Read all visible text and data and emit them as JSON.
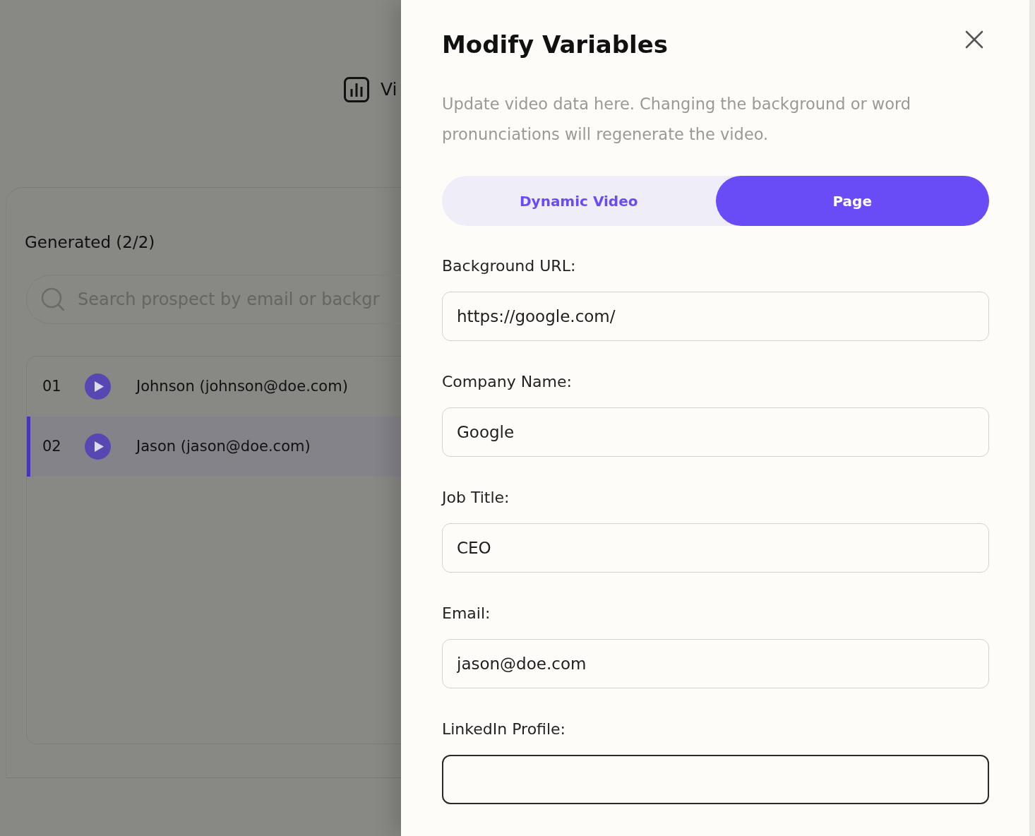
{
  "background_page": {
    "toolbar_button": {
      "label": "Vi"
    },
    "section": {
      "title": "Generated (2/2)",
      "search": {
        "placeholder": "Search prospect by email or backgr"
      },
      "prospects": [
        {
          "number": "01",
          "label": "Johnson (johnson@doe.com)",
          "selected": false
        },
        {
          "number": "02",
          "label": "Jason (jason@doe.com)",
          "selected": true
        }
      ]
    }
  },
  "drawer": {
    "title": "Modify Variables",
    "description": "Update video data here. Changing the background or word pronunciations will regenerate the video.",
    "tabs": [
      {
        "label": "Dynamic Video",
        "selected": false
      },
      {
        "label": "Page",
        "selected": true
      }
    ],
    "fields": [
      {
        "label": "Background URL:",
        "value": "https://google.com/",
        "focused": false
      },
      {
        "label": "Company Name:",
        "value": "Google",
        "focused": false
      },
      {
        "label": "Job Title:",
        "value": "CEO",
        "focused": false
      },
      {
        "label": "Email:",
        "value": "jason@doe.com",
        "focused": false
      },
      {
        "label": "LinkedIn Profile:",
        "focused": true
      }
    ]
  }
}
